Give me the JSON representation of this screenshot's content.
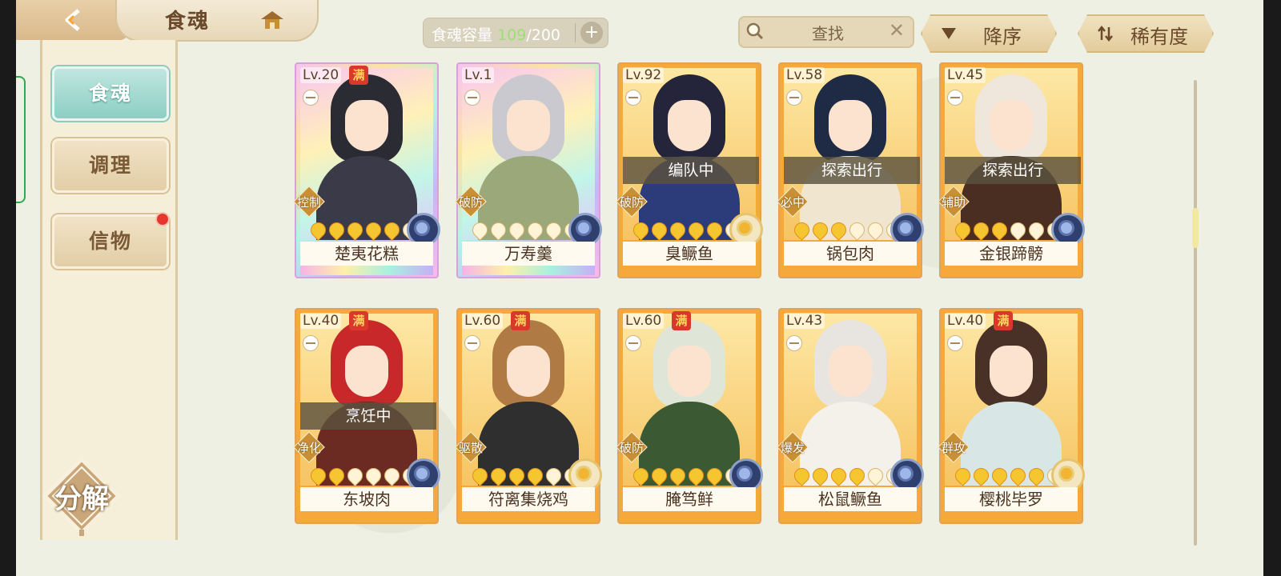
{
  "header": {
    "title": "食魂"
  },
  "capacity": {
    "label": "食魂容量",
    "current": "109",
    "max": "/200"
  },
  "search": {
    "placeholder": "查找"
  },
  "sort": {
    "order_label": "降序",
    "rarity_label": "稀有度"
  },
  "sidebar": {
    "items": [
      {
        "label": "食魂",
        "active": true
      },
      {
        "label": "调理",
        "active": false
      },
      {
        "label": "信物",
        "active": false,
        "badge": true
      }
    ]
  },
  "decompose": {
    "label": "分解"
  },
  "colors": {
    "accent": "#8ccfc4",
    "card_gold": "#f6a83a",
    "badge_red": "#d8392b"
  },
  "cards": [
    {
      "level": "Lv.20",
      "max": "满",
      "status": "",
      "role": "控制",
      "stars": 5,
      "name": "楚夷花糕",
      "rainbow": true,
      "element": "blue",
      "hair": "#2b2b33",
      "outfit": "#3a3a48"
    },
    {
      "level": "Lv.1",
      "max": "",
      "status": "",
      "role": "破防",
      "stars": 0,
      "name": "万寿羹",
      "rainbow": true,
      "element": "blue",
      "hair": "#c9c9cf",
      "outfit": "#9aa87a"
    },
    {
      "level": "Lv.92",
      "max": "",
      "status": "编队中",
      "role": "破防",
      "stars": 5,
      "name": "臭鳜鱼",
      "rainbow": false,
      "element": "gold",
      "hair": "#24243a",
      "outfit": "#2c3b7a"
    },
    {
      "level": "Lv.58",
      "max": "",
      "status": "探索出行",
      "role": "必中",
      "stars": 3,
      "name": "锅包肉",
      "rainbow": false,
      "element": "blue",
      "hair": "#1f2a45",
      "outfit": "#f0e6d0"
    },
    {
      "level": "Lv.45",
      "max": "",
      "status": "探索出行",
      "role": "辅助",
      "stars": 3,
      "name": "金银蹄髈",
      "rainbow": false,
      "element": "blue",
      "hair": "#efe6dc",
      "outfit": "#4a2e22"
    },
    {
      "level": "Lv.40",
      "max": "满",
      "status": "烹饪中",
      "role": "净化",
      "stars": 2,
      "name": "东坡肉",
      "rainbow": false,
      "element": "blue",
      "hair": "#c8282a",
      "outfit": "#6b2a22"
    },
    {
      "level": "Lv.60",
      "max": "满",
      "status": "",
      "role": "驱散",
      "stars": 4,
      "name": "符离集烧鸡",
      "rainbow": false,
      "element": "gold",
      "hair": "#b07a45",
      "outfit": "#2f2f2f"
    },
    {
      "level": "Lv.60",
      "max": "满",
      "status": "",
      "role": "破防",
      "stars": 5,
      "name": "腌笃鲜",
      "rainbow": false,
      "element": "blue",
      "hair": "#dfe6d8",
      "outfit": "#3b5a33"
    },
    {
      "level": "Lv.43",
      "max": "",
      "status": "",
      "role": "爆发",
      "stars": 4,
      "name": "松鼠鳜鱼",
      "rainbow": false,
      "element": "blue",
      "hair": "#e8e4e0",
      "outfit": "#f4f0ea"
    },
    {
      "level": "Lv.40",
      "max": "满",
      "status": "",
      "role": "群攻",
      "stars": 5,
      "name": "樱桃毕罗",
      "rainbow": false,
      "element": "gold",
      "hair": "#4a3128",
      "outfit": "#d8e6e6"
    }
  ]
}
